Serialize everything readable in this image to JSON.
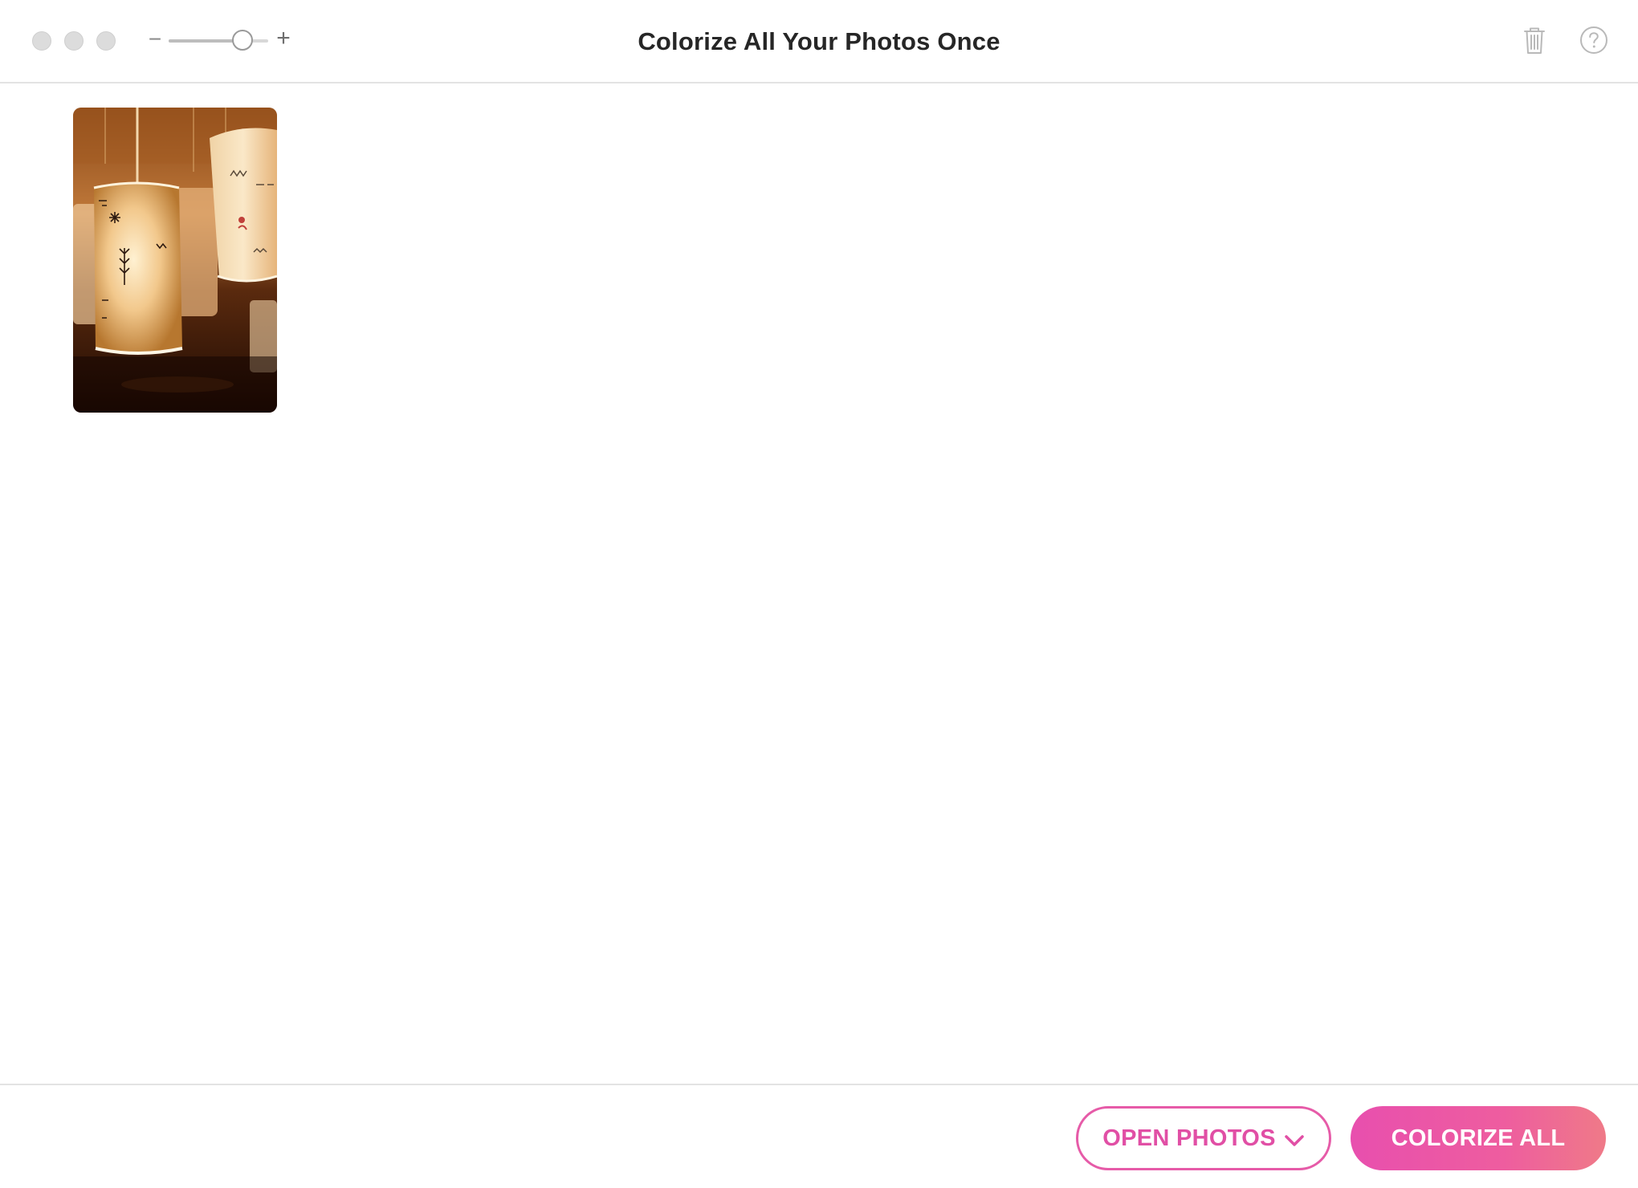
{
  "window": {
    "title": "Colorize All Your Photos Once"
  },
  "toolbar": {
    "zoom_minus_label": "−",
    "zoom_plus_label": "+",
    "zoom_level": 0.74,
    "trash_icon": "trash-icon",
    "help_icon": "help-icon"
  },
  "photos": [
    {
      "kind": "thumbnail",
      "subject": "hanging fabric lanterns"
    }
  ],
  "footer": {
    "open_photos_label": "OPEN PHOTOS",
    "open_photos_icon": "chevron-down-icon",
    "colorize_all_label": "COLORIZE ALL"
  },
  "colors": {
    "accent": "#e84fae",
    "accent_end": "#ef7a88",
    "title_text": "#262626",
    "divider": "#e3e3e3"
  }
}
